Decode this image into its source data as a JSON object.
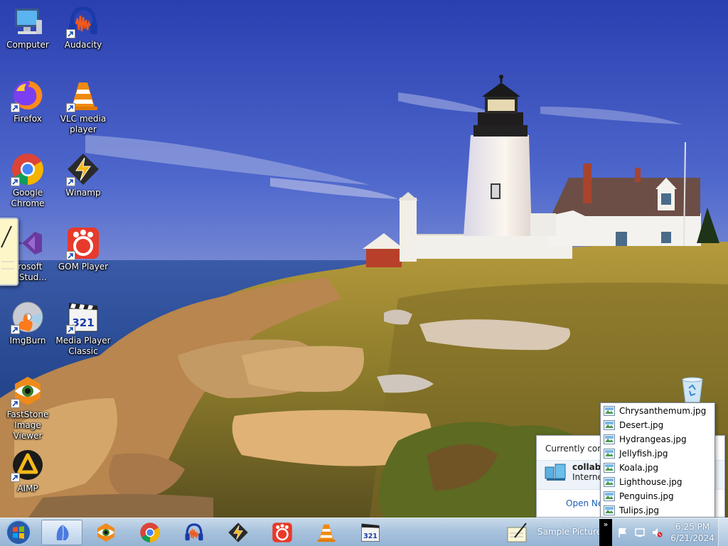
{
  "desktop": {
    "icons": [
      {
        "label": "Computer"
      },
      {
        "label": "Audacity"
      },
      {
        "label": "Firefox"
      },
      {
        "label": "VLC media\nplayer"
      },
      {
        "label": "Google\nChrome"
      },
      {
        "label": "Winamp"
      },
      {
        "label": "crosoft\nal Stud..."
      },
      {
        "label": "GOM Player"
      },
      {
        "label": "ImgBurn"
      },
      {
        "label": "Media Player\nClassic"
      },
      {
        "label": "FastStone\nImage Viewer"
      },
      {
        "label": "AIMP"
      }
    ]
  },
  "network_flyout": {
    "header": "Currently conn",
    "network_name": "collabn",
    "network_sub": "Interne",
    "open_link": "Open Ne"
  },
  "file_popup": {
    "items": [
      "Chrysanthemum.jpg",
      "Desert.jpg",
      "Hydrangeas.jpg",
      "Jellyfish.jpg",
      "Koala.jpg",
      "Lighthouse.jpg",
      "Penguins.jpg",
      "Tulips.jpg"
    ]
  },
  "taskbar": {
    "pinned": [
      "IE / Chrome-like",
      "FastStone Image Viewer",
      "Google Chrome",
      "Audacity",
      "Winamp",
      "GOM Player",
      "VLC media player",
      "Media Player Classic"
    ],
    "toolbar_label": "Sample Pictures",
    "chevron": "»",
    "clock_time": "6:25 PM",
    "clock_date": "6/21/2024"
  },
  "colors": {
    "taskbar": "#a9c3dd",
    "link": "#1a5fb4"
  }
}
